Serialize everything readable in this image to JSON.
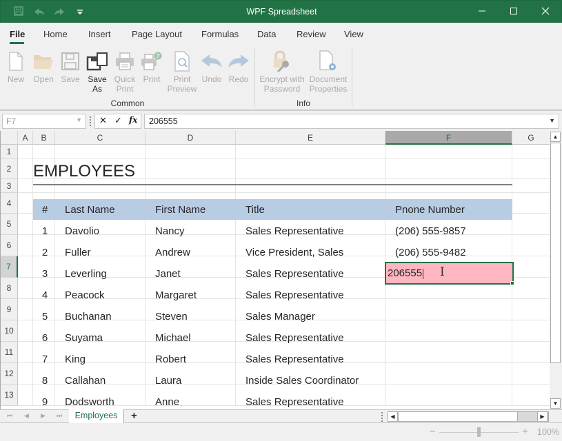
{
  "window": {
    "title": "WPF Spreadsheet",
    "controls": {
      "minimize": "—",
      "maximize": "☐",
      "close": "✕"
    }
  },
  "quick_access": {
    "save_icon": "💾",
    "undo_icon": "↶",
    "redo_icon": "↷",
    "customize_icon": "▾"
  },
  "ribbon_tabs": [
    {
      "label": "File",
      "active": true
    },
    {
      "label": "Home"
    },
    {
      "label": "Insert"
    },
    {
      "label": "Page Layout"
    },
    {
      "label": "Formulas"
    },
    {
      "label": "Data"
    },
    {
      "label": "Review"
    },
    {
      "label": "View"
    }
  ],
  "ribbon": {
    "groups": [
      {
        "label": "Common",
        "buttons": [
          {
            "label": "New",
            "line2": "",
            "enabled": false
          },
          {
            "label": "Open",
            "line2": "",
            "enabled": false
          },
          {
            "label": "Save",
            "line2": "",
            "enabled": false
          },
          {
            "label": "Save",
            "line2": "As",
            "enabled": true
          },
          {
            "label": "Quick",
            "line2": "Print",
            "enabled": false
          },
          {
            "label": "Print",
            "line2": "",
            "enabled": false
          },
          {
            "label": "Print",
            "line2": "Preview",
            "enabled": false
          },
          {
            "label": "Undo",
            "line2": "",
            "enabled": false
          },
          {
            "label": "Redo",
            "line2": "",
            "enabled": false
          }
        ]
      },
      {
        "label": "Info",
        "buttons": [
          {
            "label": "Encrypt with",
            "line2": "Password",
            "enabled": false
          },
          {
            "label": "Document",
            "line2": "Properties",
            "enabled": false
          }
        ]
      }
    ]
  },
  "formula_bar": {
    "name_box": "F7",
    "cancel": "✕",
    "enter": "✓",
    "fx": "fx",
    "value": "206555"
  },
  "columns": [
    "A",
    "B",
    "C",
    "D",
    "E",
    "F",
    "G"
  ],
  "selected_column": "F",
  "rows": [
    "1",
    "2",
    "3",
    "4",
    "5",
    "6",
    "7",
    "8",
    "9",
    "10",
    "11",
    "12",
    "13"
  ],
  "selected_row": "7",
  "sheet": {
    "title": "EMPLOYEES",
    "headers": [
      "#",
      "Last Name",
      "First Name",
      "Title",
      "Pnone Number"
    ],
    "records": [
      [
        "1",
        "Davolio",
        "Nancy",
        "Sales Representative",
        "(206) 555-9857"
      ],
      [
        "2",
        "Fuller",
        "Andrew",
        "Vice President, Sales",
        "(206) 555-9482"
      ],
      [
        "3",
        "Leverling",
        "Janet",
        "Sales Representative",
        "206555"
      ],
      [
        "4",
        "Peacock",
        "Margaret",
        "Sales Representative",
        ""
      ],
      [
        "5",
        "Buchanan",
        "Steven",
        "Sales Manager",
        ""
      ],
      [
        "6",
        "Suyama",
        "Michael",
        "Sales Representative",
        ""
      ],
      [
        "7",
        "King",
        "Robert",
        "Sales Representative",
        ""
      ],
      [
        "8",
        "Callahan",
        "Laura",
        "Inside Sales Coordinator",
        ""
      ],
      [
        "9",
        "Dodsworth",
        "Anne",
        "Sales Representative",
        ""
      ]
    ],
    "editing_cell_value": "206555",
    "editing_cell_color": "#ffb6c1"
  },
  "sheet_tabs": {
    "tabs": [
      "Employees"
    ],
    "active": "Employees",
    "add_label": "+",
    "nav": [
      "⏮",
      "◀",
      "▶",
      "⏭"
    ]
  },
  "status": {
    "zoom_minus": "−",
    "zoom_plus": "+",
    "zoom_percent": "100%",
    "zoom_level": 100
  },
  "colors": {
    "accent": "#217346",
    "header_band": "#b8cce4"
  }
}
